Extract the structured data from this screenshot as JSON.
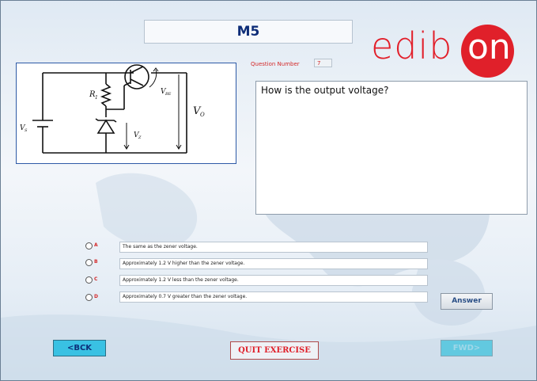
{
  "header": {
    "title": "M5"
  },
  "logo": {
    "brand_part": "edib",
    "brand_circle": "on"
  },
  "question": {
    "number_label": "Question Number",
    "number_value": "7",
    "text": "How is the output voltage?"
  },
  "circuit": {
    "labels": {
      "r1": "R",
      "r1_sub": "1",
      "vbe": "V",
      "vbe_sub": "BE",
      "vo": "V",
      "vo_sub": "O",
      "vz": "V",
      "vz_sub": "Z",
      "vs": "V",
      "vs_sub": "S"
    }
  },
  "options": [
    {
      "letter": "A",
      "text": "The same as the zener voltage."
    },
    {
      "letter": "B",
      "text": "Approximately 1.2 V higher than the zener voltage."
    },
    {
      "letter": "C",
      "text": "Approximately 1.2 V less than the zener voltage."
    },
    {
      "letter": "D",
      "text": "Approximately 0.7 V greater than the zener voltage."
    }
  ],
  "buttons": {
    "answer": "Answer",
    "back": "<BCK",
    "quit": "QUIT EXERCISE",
    "forward": "FWD>"
  },
  "colors": {
    "accent_red": "#e0202a",
    "title_blue": "#0e2d78",
    "nav_cyan": "#39c1e3"
  }
}
